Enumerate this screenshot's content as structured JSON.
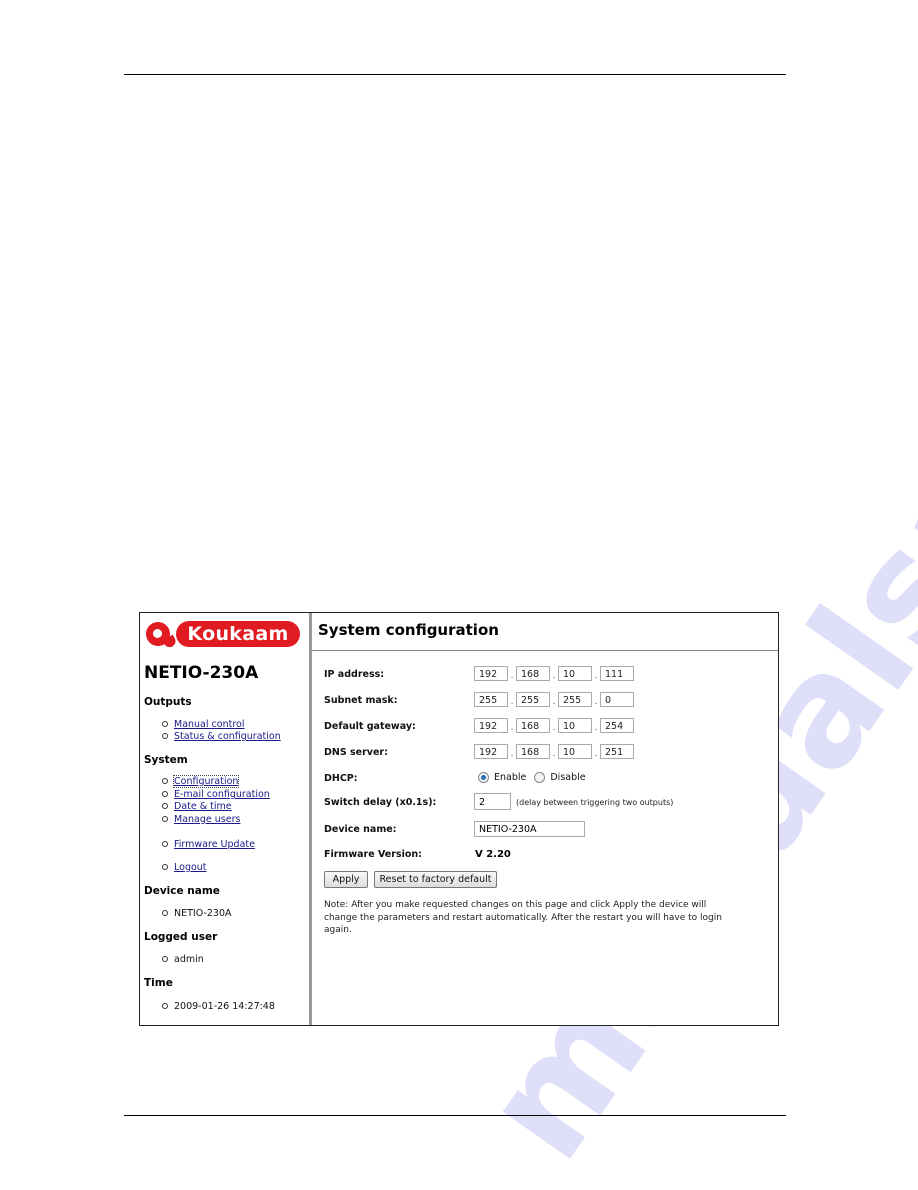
{
  "watermark": "manualsarchive.com",
  "brand": {
    "logo_text": "Koukaam",
    "logo_color": "#e11b22"
  },
  "sidebar": {
    "device_title": "NETIO-230A",
    "sections": [
      {
        "heading": "Outputs",
        "items": [
          {
            "label": "Manual control",
            "link": true
          },
          {
            "label": "Status & configuration",
            "link": true
          }
        ]
      },
      {
        "heading": "System",
        "items": [
          {
            "label": "Configuration",
            "link": true,
            "active": true
          },
          {
            "label": "E-mail configuration",
            "link": true
          },
          {
            "label": "Date & time",
            "link": true
          },
          {
            "label": "Manage users",
            "link": true
          },
          {
            "label": "Firmware Update",
            "link": true
          },
          {
            "label": "Logout",
            "link": true
          }
        ]
      },
      {
        "heading": "Device name",
        "items": [
          {
            "label": "NETIO-230A",
            "link": false
          }
        ]
      },
      {
        "heading": "Logged user",
        "items": [
          {
            "label": "admin",
            "link": false
          }
        ]
      },
      {
        "heading": "Time",
        "items": [
          {
            "label": "2009-01-26 14:27:48",
            "link": false
          }
        ]
      }
    ]
  },
  "main": {
    "title": "System configuration",
    "fields": {
      "ip_address": {
        "label": "IP address:",
        "octets": [
          "192",
          "168",
          "10",
          "111"
        ]
      },
      "subnet_mask": {
        "label": "Subnet mask:",
        "octets": [
          "255",
          "255",
          "255",
          "0"
        ]
      },
      "default_gateway": {
        "label": "Default gateway:",
        "octets": [
          "192",
          "168",
          "10",
          "254"
        ]
      },
      "dns_server": {
        "label": "DNS server:",
        "octets": [
          "192",
          "168",
          "10",
          "251"
        ]
      },
      "dhcp": {
        "label": "DHCP:",
        "options": [
          "Enable",
          "Disable"
        ],
        "selected": "Enable"
      },
      "switch_delay": {
        "label": "Switch delay (x0.1s):",
        "value": "2",
        "note": "(delay between triggering two outputs)"
      },
      "device_name": {
        "label": "Device name:",
        "value": "NETIO-230A"
      },
      "firmware": {
        "label": "Firmware Version:",
        "value": "V 2.20"
      }
    },
    "buttons": {
      "apply": "Apply",
      "reset": "Reset to factory default"
    },
    "note": "Note: After you make requested changes on this page and click Apply the device will change the parameters and restart automatically. After the restart you will have to login again."
  }
}
